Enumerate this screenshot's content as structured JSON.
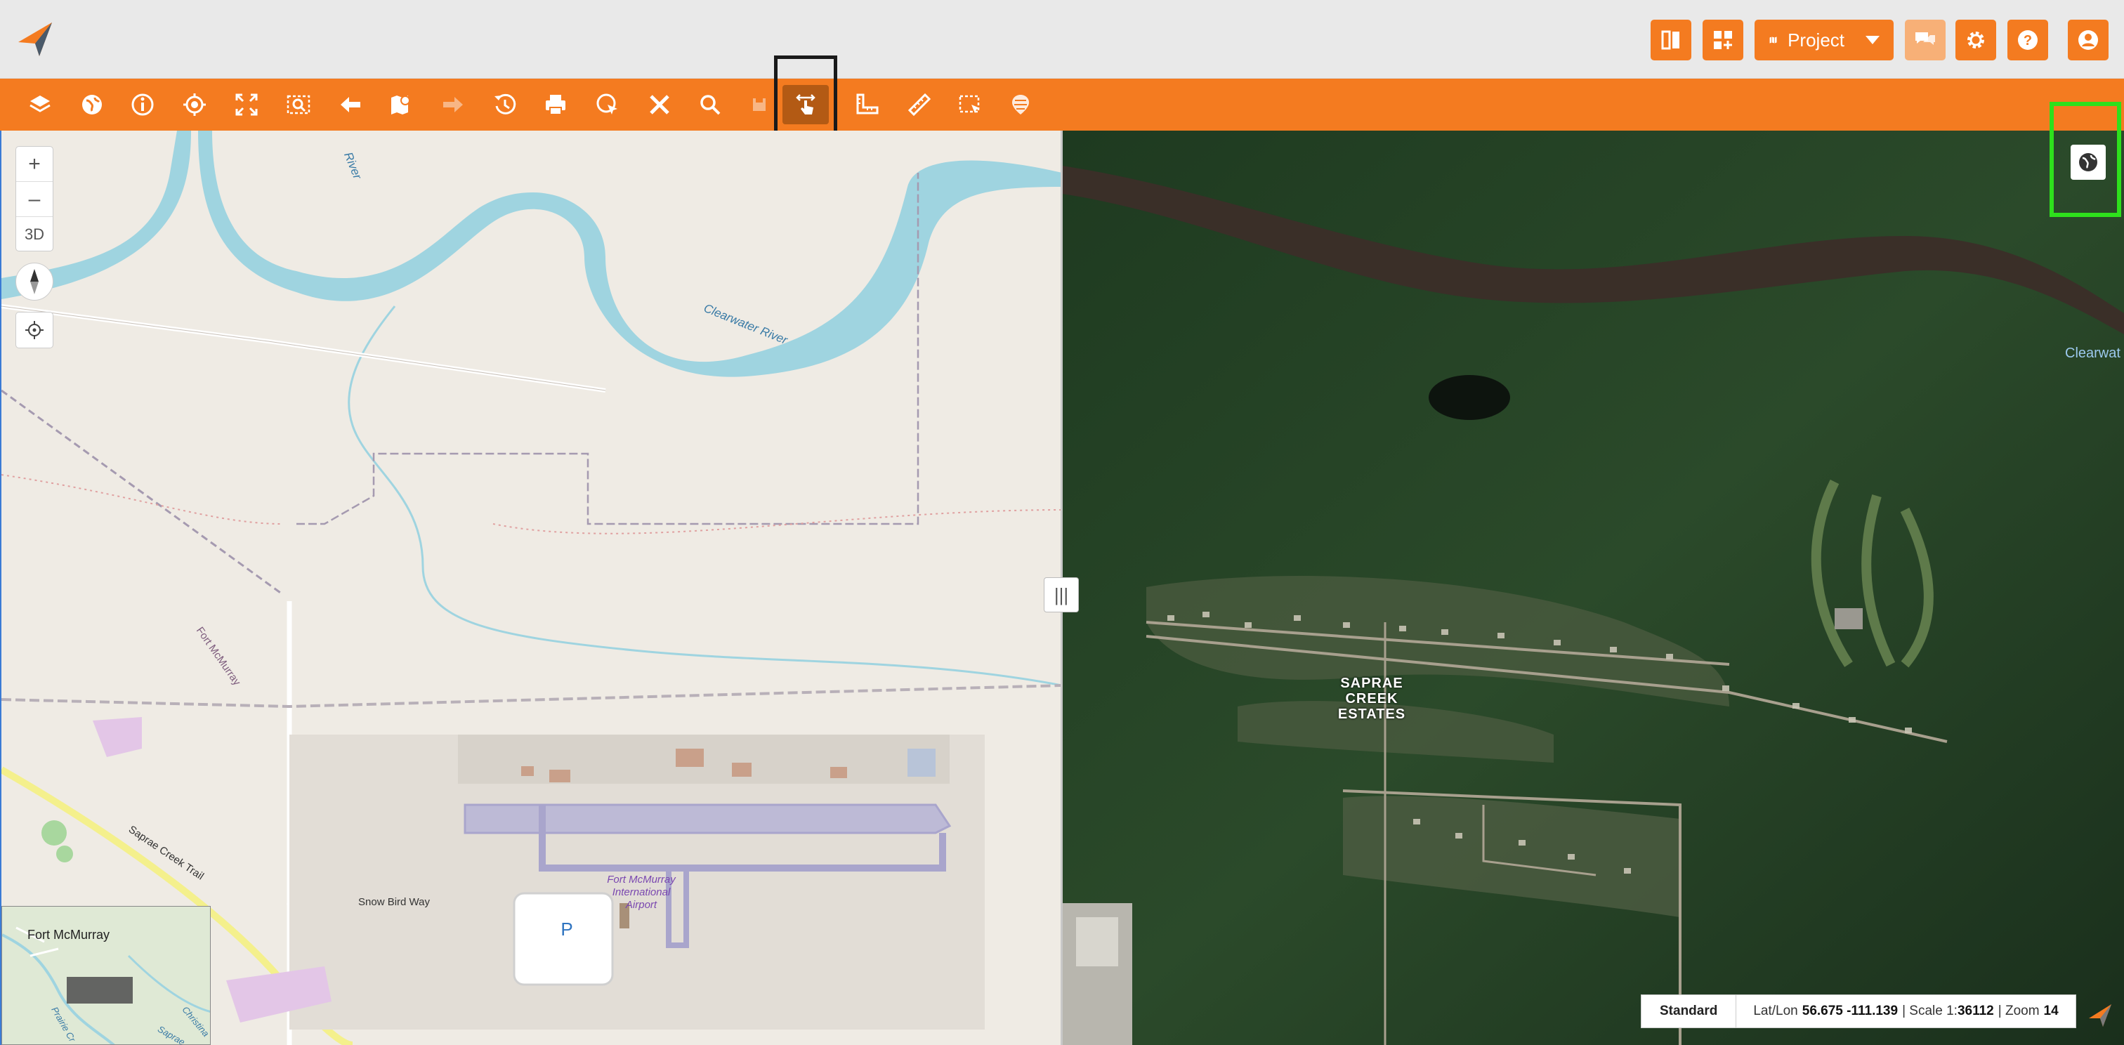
{
  "header": {
    "project_label": "Project",
    "buttons": [
      "split-view",
      "add-widget",
      "project",
      "chat",
      "settings",
      "help",
      "user"
    ]
  },
  "toolbar": {
    "tools": [
      "layers",
      "basemaps",
      "identify",
      "go-to-location",
      "full-extent",
      "zoom-to-selection",
      "previous-extent",
      "bookmarks",
      "next-extent",
      "history",
      "print",
      "select-features",
      "drawing-tools",
      "search",
      "save",
      "swipe",
      "measure",
      "ruler",
      "select-area",
      "heatmap"
    ]
  },
  "map_left": {
    "zoom_in": "+",
    "zoom_out": "–",
    "mode_3d": "3D",
    "labels": {
      "river": "Clearwater River",
      "river_north": "River",
      "rail": "Fort McMurray",
      "trail": "Saprae Creek Trail",
      "road": "Snow Bird Way",
      "airport": "Fort McMurray International Airport",
      "parking": "P"
    },
    "minimap": {
      "label": "Fort McMurray",
      "water_1": "Christina",
      "water_2": "Prairie Cr",
      "water_3": "Saprae"
    }
  },
  "map_right": {
    "place_label": "SAPRAE CREEK ESTATES",
    "water_label": "Clearwat"
  },
  "swipe_handle": "|||",
  "status": {
    "basemap": "Standard",
    "latlon_label": "Lat/Lon",
    "latlon_value": "56.675 -111.139",
    "scale_label": "| Scale 1:",
    "scale_value": "36112",
    "zoom_label": "| Zoom",
    "zoom_value": "14"
  },
  "colors": {
    "brand_orange": "#f47b20",
    "active_tool": "#b35a14",
    "highlight_green": "#2ee01c",
    "water": "#9fd4e0"
  }
}
